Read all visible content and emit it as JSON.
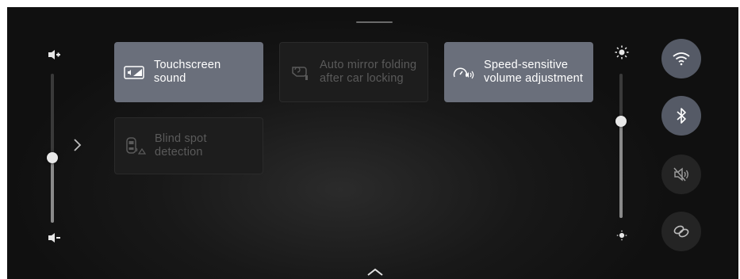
{
  "tiles": [
    {
      "label": "Touchscreen sound",
      "icon": "touchscreen-sound-icon",
      "active": true
    },
    {
      "label": "Auto mirror folding after car locking",
      "icon": "mirror-fold-icon",
      "active": false
    },
    {
      "label": "Speed-sensitive volume adjustment",
      "icon": "speed-volume-icon",
      "active": true
    },
    {
      "label": "Blind spot detection",
      "icon": "blind-spot-icon",
      "active": false
    }
  ],
  "volume_slider": {
    "level": 0.4,
    "increase_icon": "volume-up-icon",
    "decrease_icon": "volume-down-icon"
  },
  "brightness_slider": {
    "level": 0.67,
    "increase_icon": "brightness-up-icon",
    "decrease_icon": "brightness-down-icon"
  },
  "quick_buttons": [
    {
      "icon": "wifi-icon",
      "active": true
    },
    {
      "icon": "bluetooth-icon",
      "active": true
    },
    {
      "icon": "speaker-mute-icon",
      "active": false
    },
    {
      "icon": "link-icon",
      "active": false
    }
  ],
  "colors": {
    "active_tile": "#6a6f7b",
    "active_button": "#555a66",
    "background": "#181818"
  }
}
